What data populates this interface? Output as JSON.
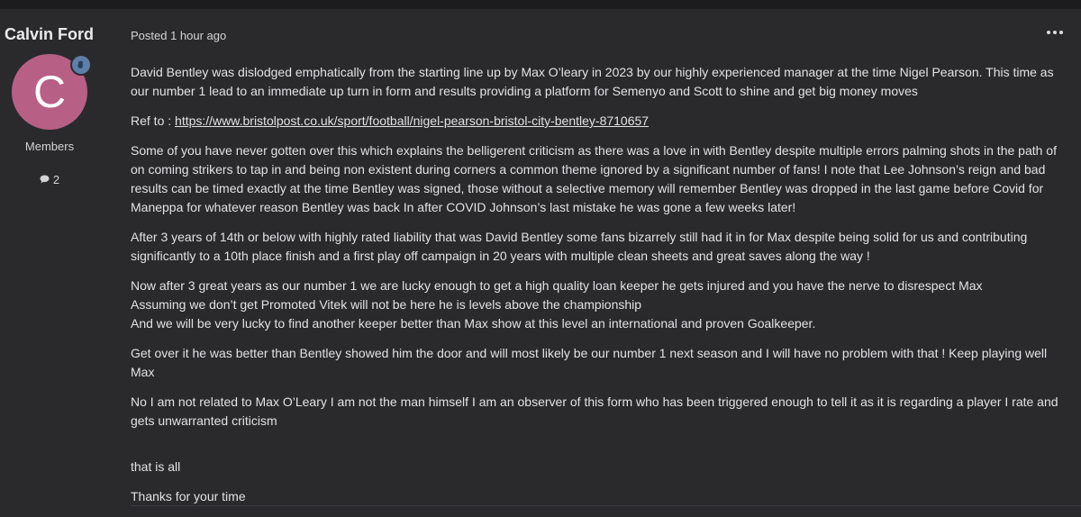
{
  "author": {
    "name": "Calvin Ford",
    "avatar_letter": "C",
    "avatar_color": "#b85f86",
    "badge_icon": "hand-badge-icon",
    "group": "Members",
    "post_count": "2"
  },
  "post": {
    "meta": "Posted 1 hour ago",
    "options_icon": "more-options-icon",
    "paragraphs": [
      "David Bentley was dislodged emphatically from the starting line up by Max O’leary in 2023 by our highly experienced manager at the time Nigel Pearson. This time as our number 1 lead to an immediate up turn in form and results providing a platform for Semenyo and Scott to shine and get big money moves",
      "Some of you have never gotten over this which explains the belligerent criticism as there was a love in with Bentley despite multiple errors palming shots in the path of on coming strikers to tap in and being non existent during corners a common theme ignored by a significant number of fans! I note that Lee Johnson’s reign and bad results can be timed exactly at the time Bentley was signed, those without a selective memory will remember Bentley was dropped in the last game before Covid for Maneppa for whatever reason Bentley was back In after COVID Johnson’s last mistake he was gone a few weeks later!",
      "After 3 years of 14th or below with highly rated liability that was David Bentley some fans bizarrely  still had it in for Max despite being solid for us and contributing significantly to a 10th place finish and a first play off campaign in 20 years with multiple clean sheets and great saves along the way !",
      "Get over it he was better than Bentley showed him the door and will most likely be our number 1 next season and I will have no problem with that ! Keep playing well Max",
      "No I am not related to Max O’Leary I am not the man himself I am an observer of this form who has been triggered enough to tell it as it is regarding a player I rate and gets unwarranted criticism",
      "that is all",
      "Thanks for your time"
    ],
    "ref_label": "Ref to : ",
    "ref_link": "https://www.bristolpost.co.uk/sport/football/nigel-pearson-bristol-city-bentley-8710657",
    "multi_lines": [
      "Now after 3 great years as our number 1 we are lucky enough to get a high quality loan keeper he gets injured and you have the nerve to disrespect Max",
      "Assuming we don’t get Promoted Vitek will not be here he is levels above the championship",
      "And we will be very lucky to find another keeper better than Max show at this level an international and proven Goalkeeper."
    ]
  }
}
